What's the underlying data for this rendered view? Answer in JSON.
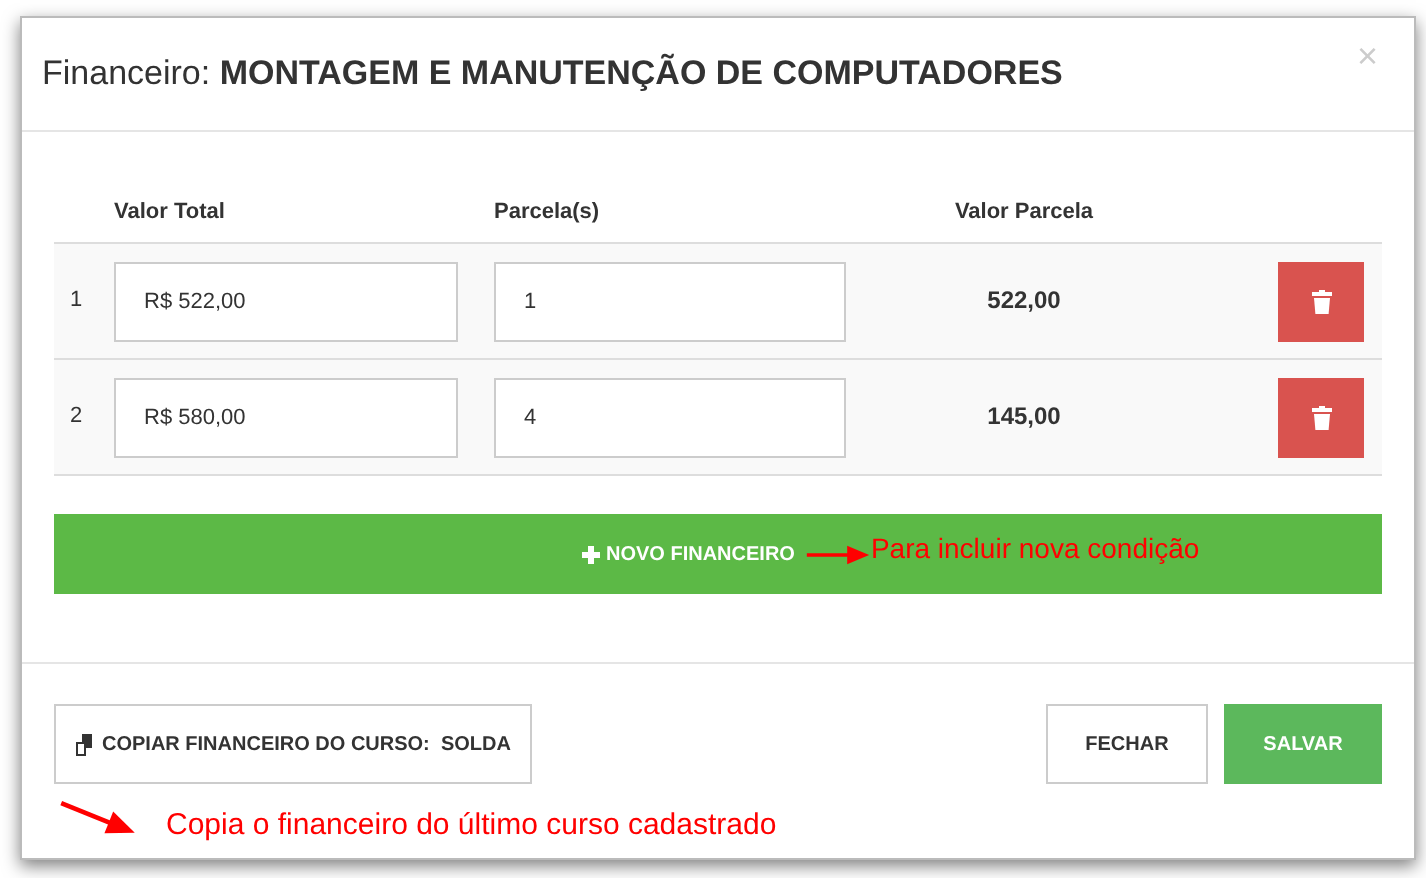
{
  "modal": {
    "title_prefix": "Financeiro:",
    "title": "MONTAGEM E MANUTENÇÃO DE COMPUTADORES",
    "close": "×"
  },
  "table": {
    "columns": [
      "Valor Total",
      "Parcela(s)",
      "Valor Parcela"
    ],
    "rows": [
      {
        "index": "1",
        "valor_total": "R$ 522,00",
        "parcelas": "1",
        "valor_parcela": "522,00"
      },
      {
        "index": "2",
        "valor_total": "R$ 580,00",
        "parcelas": "4",
        "valor_parcela": "145,00"
      }
    ]
  },
  "add_button": "NOVO FINANCEIRO",
  "add_note": "Para incluir nova condição",
  "copy_button": "COPIAR FINANCEIRO DO CURSO:  SOLDA",
  "copy_note": "Copia o financeiro do último curso cadastrado",
  "buttons": [
    "FECHAR",
    "SALVAR"
  ]
}
